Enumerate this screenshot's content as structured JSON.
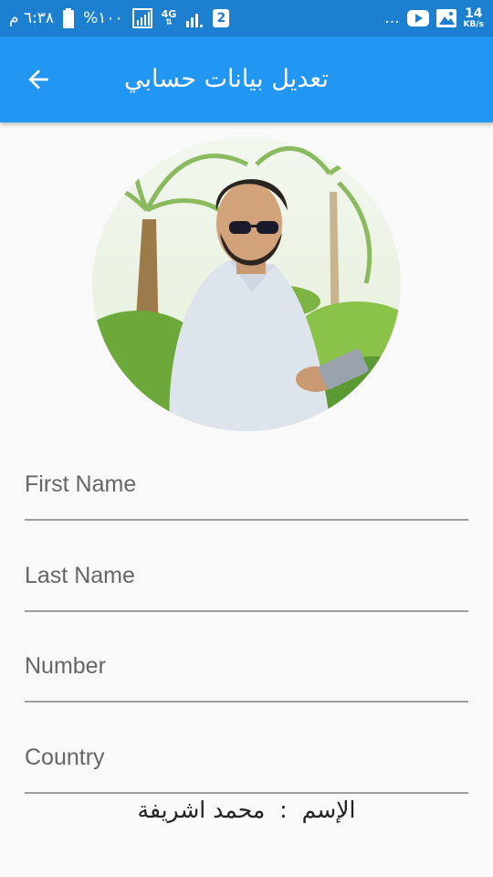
{
  "status_bar": {
    "time": "٦:٣٨ م",
    "battery": "%١٠٠",
    "network": "4G",
    "sim_badge": "2",
    "more": "...",
    "speed_value": "14",
    "speed_unit": "KB/s"
  },
  "app_bar": {
    "title": "تعديل بيانات حسابي",
    "back_icon": "arrow-back-icon"
  },
  "colors": {
    "status_bar": "#1c7fd0",
    "app_bar": "#2196f3",
    "background": "#f9f9f9",
    "underline": "#9e9e9e",
    "label": "#666666"
  },
  "form": {
    "first_name": {
      "placeholder": "First Name",
      "value": ""
    },
    "last_name": {
      "placeholder": "Last Name",
      "value": ""
    },
    "number": {
      "placeholder": "Number",
      "value": ""
    },
    "country": {
      "placeholder": "Country",
      "value": ""
    }
  },
  "profile": {
    "name_label": "الإسم",
    "separator": ":",
    "name_value": "محمد اشريفة"
  }
}
